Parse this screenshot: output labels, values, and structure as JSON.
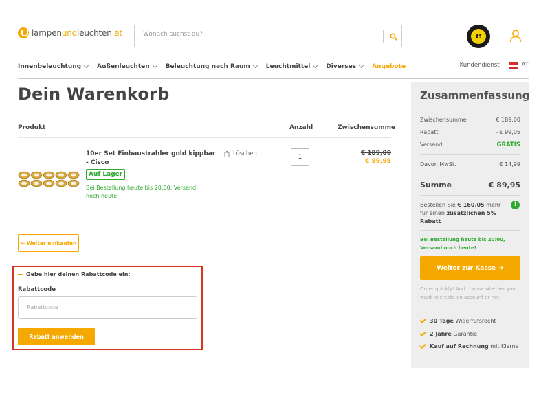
{
  "header": {
    "logo_part1": "lampen",
    "logo_part2": "und",
    "logo_part3": "leuchten",
    "logo_part4": ".at",
    "search_placeholder": "Wonach suchst du?",
    "trust_badge_letter": "e"
  },
  "nav": {
    "items": [
      {
        "label": "Innenbeleuchtung"
      },
      {
        "label": "Außenleuchten"
      },
      {
        "label": "Beleuchtung nach Raum"
      },
      {
        "label": "Leuchtmittel"
      },
      {
        "label": "Diverses"
      }
    ],
    "offer_label": "Angebote",
    "service_label": "Kundendienst",
    "country_label": "AT"
  },
  "cart": {
    "title": "Dein Warenkorb",
    "col_product": "Produkt",
    "col_qty": "Anzahl",
    "col_subtotal": "Zwischensumme",
    "item": {
      "title": "10er Set Einbaustrahler gold kippbar - Cisco",
      "stock": "Auf Lager",
      "shipping_note": "Bei Bestellung heute bis 20:00, Versand noch heute!",
      "delete_label": "Löschen",
      "quantity": "1",
      "old_price": "€ 189,00",
      "new_price": "€ 89,95"
    },
    "continue_label": "← Weiter einkaufen"
  },
  "coupon": {
    "toggle_label": "Gebe hier deinen Rabattcode ein:",
    "field_label": "Rabattcode",
    "placeholder": "Rabattcode",
    "button_label": "Rabatt anwenden"
  },
  "summary": {
    "title": "Zusammenfassung",
    "rows": [
      {
        "label": "Zwischensumme",
        "value": "€ 189,00"
      },
      {
        "label": "Rabatt",
        "value": "- € 99,05"
      },
      {
        "label": "Versand",
        "value": "GRATIS"
      }
    ],
    "vat_label": "Davon MwSt.",
    "vat_value": "€ 14,99",
    "total_label": "Summe",
    "total_value": "€ 89,95",
    "promo_prefix": "Bestellen Sie ",
    "promo_amount": "€ 160,05",
    "promo_middle": " mehr für einen ",
    "promo_bold": "zusätzlichen 5% Rabatt",
    "promo_icon": "!",
    "shipping_note": "Bei Bestellung heute bis 20:00, Versand noch heute!",
    "checkout_label": "Weiter zur Kasse",
    "checkout_arrow": "➜",
    "order_note": "Order quickly! And choose whether you want to create an account or not.",
    "usps": [
      {
        "bold": "30 Tage",
        "text": " Widerrufsrecht"
      },
      {
        "bold": "2 Jahre",
        "text": " Garantie"
      },
      {
        "bold": "Kauf auf Rechnung",
        "text": " mit Klarna"
      }
    ]
  },
  "colors": {
    "accent": "#f5a800",
    "success": "#2eaa2e",
    "highlight_border": "#d9341f"
  }
}
